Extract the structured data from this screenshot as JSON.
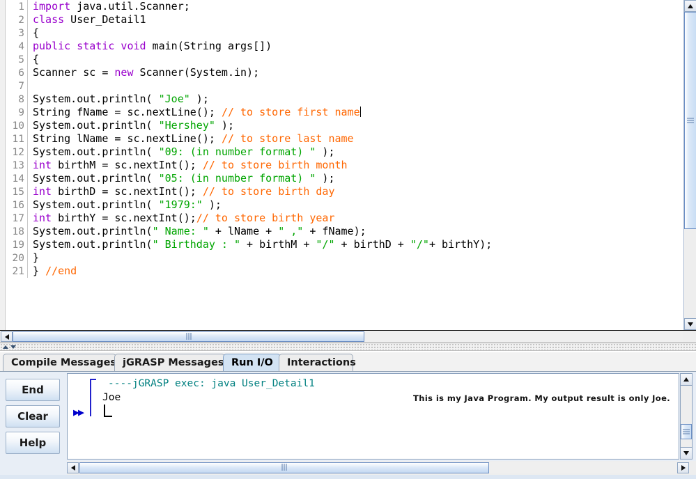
{
  "editor": {
    "language": "java",
    "caret_line": 9,
    "lines": [
      {
        "n": "1",
        "tokens": [
          {
            "t": "import",
            "c": "kw"
          },
          {
            "t": " java.util.Scanner;",
            "c": "pl"
          }
        ]
      },
      {
        "n": "2",
        "tokens": [
          {
            "t": "class",
            "c": "kw"
          },
          {
            "t": " User_Detail1",
            "c": "pl"
          }
        ]
      },
      {
        "n": "3",
        "tokens": [
          {
            "t": "{",
            "c": "pl"
          }
        ]
      },
      {
        "n": "4",
        "tokens": [
          {
            "t": "public static void",
            "c": "kw"
          },
          {
            "t": " main(String args[])",
            "c": "pl"
          }
        ]
      },
      {
        "n": "5",
        "tokens": [
          {
            "t": "{",
            "c": "pl"
          }
        ]
      },
      {
        "n": "6",
        "tokens": [
          {
            "t": "Scanner sc = ",
            "c": "pl"
          },
          {
            "t": "new",
            "c": "kw"
          },
          {
            "t": " Scanner(System.in);",
            "c": "pl"
          }
        ]
      },
      {
        "n": "7",
        "tokens": []
      },
      {
        "n": "8",
        "tokens": [
          {
            "t": "System.out.println( ",
            "c": "pl"
          },
          {
            "t": "\"Joe\"",
            "c": "str"
          },
          {
            "t": " );",
            "c": "pl"
          }
        ]
      },
      {
        "n": "9",
        "tokens": [
          {
            "t": "String fName = sc.nextLine(); ",
            "c": "pl"
          },
          {
            "t": "// to store first name",
            "c": "cmt"
          }
        ]
      },
      {
        "n": "10",
        "tokens": [
          {
            "t": "System.out.println( ",
            "c": "pl"
          },
          {
            "t": "\"Hershey\"",
            "c": "str"
          },
          {
            "t": " );",
            "c": "pl"
          }
        ]
      },
      {
        "n": "11",
        "tokens": [
          {
            "t": "String lName = sc.nextLine(); ",
            "c": "pl"
          },
          {
            "t": "// to store last name",
            "c": "cmt"
          }
        ]
      },
      {
        "n": "12",
        "tokens": [
          {
            "t": "System.out.println( ",
            "c": "pl"
          },
          {
            "t": "\"09: (in number format) \"",
            "c": "str"
          },
          {
            "t": " );",
            "c": "pl"
          }
        ]
      },
      {
        "n": "13",
        "tokens": [
          {
            "t": "int",
            "c": "kw"
          },
          {
            "t": " birthM = sc.nextInt(); ",
            "c": "pl"
          },
          {
            "t": "// to store birth month",
            "c": "cmt"
          }
        ]
      },
      {
        "n": "14",
        "tokens": [
          {
            "t": "System.out.println( ",
            "c": "pl"
          },
          {
            "t": "\"05: (in number format) \"",
            "c": "str"
          },
          {
            "t": " );",
            "c": "pl"
          }
        ]
      },
      {
        "n": "15",
        "tokens": [
          {
            "t": "int",
            "c": "kw"
          },
          {
            "t": " birthD = sc.nextInt(); ",
            "c": "pl"
          },
          {
            "t": "// to store birth day",
            "c": "cmt"
          }
        ]
      },
      {
        "n": "16",
        "tokens": [
          {
            "t": "System.out.println( ",
            "c": "pl"
          },
          {
            "t": "\"1979:\"",
            "c": "str"
          },
          {
            "t": " );",
            "c": "pl"
          }
        ]
      },
      {
        "n": "17",
        "tokens": [
          {
            "t": "int",
            "c": "kw"
          },
          {
            "t": " birthY = sc.nextInt();",
            "c": "pl"
          },
          {
            "t": "// to store birth year",
            "c": "cmt"
          }
        ]
      },
      {
        "n": "18",
        "tokens": [
          {
            "t": "System.out.println(",
            "c": "pl"
          },
          {
            "t": "\" Name: \"",
            "c": "str"
          },
          {
            "t": " + lName + ",
            "c": "pl"
          },
          {
            "t": "\" ,\"",
            "c": "str"
          },
          {
            "t": " + fName);",
            "c": "pl"
          }
        ]
      },
      {
        "n": "19",
        "tokens": [
          {
            "t": "System.out.println(",
            "c": "pl"
          },
          {
            "t": "\" Birthday : \"",
            "c": "str"
          },
          {
            "t": " + birthM + ",
            "c": "pl"
          },
          {
            "t": "\"/\"",
            "c": "str"
          },
          {
            "t": " + birthD + ",
            "c": "pl"
          },
          {
            "t": "\"/\"",
            "c": "str"
          },
          {
            "t": "+ birthY);",
            "c": "pl"
          }
        ]
      },
      {
        "n": "20",
        "tokens": [
          {
            "t": "}",
            "c": "pl"
          }
        ]
      },
      {
        "n": "21",
        "tokens": [
          {
            "t": "} ",
            "c": "pl"
          },
          {
            "t": "//end",
            "c": "cmt"
          }
        ]
      }
    ]
  },
  "tabs": [
    {
      "label": "Compile Messages",
      "selected": false
    },
    {
      "label": "jGRASP Messages",
      "selected": false
    },
    {
      "label": "Run I/O",
      "selected": true
    },
    {
      "label": "Interactions",
      "selected": false
    }
  ],
  "controls": {
    "end_label": "End",
    "clear_label": "Clear",
    "help_label": "Help"
  },
  "console": {
    "exec_line": "----jGRASP exec: java User_Detail1",
    "output_line": "Joe",
    "run_marker": "▶▶"
  },
  "annotation": {
    "text": "This is my Java Program. My output result is only Joe."
  },
  "colors": {
    "keyword": "#9900cc",
    "string": "#00a500",
    "comment": "#ff6600",
    "plain": "#000000",
    "exec_teal": "#008080",
    "marker_blue": "#0000cc",
    "tab_selected_bg": "#d3e3f3"
  }
}
